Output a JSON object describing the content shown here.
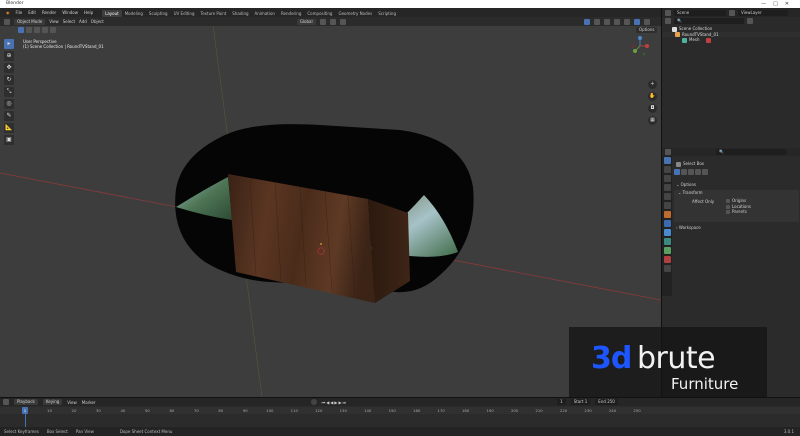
{
  "window": {
    "title": "Blender",
    "controls": [
      "—",
      "□",
      "✕"
    ]
  },
  "menubar": {
    "menus": [
      "File",
      "Edit",
      "Render",
      "Window",
      "Help"
    ],
    "workspaces": [
      "Layout",
      "Modeling",
      "Sculpting",
      "UV Editing",
      "Texture Paint",
      "Shading",
      "Animation",
      "Rendering",
      "Compositing",
      "Geometry Nodes",
      "Scripting"
    ],
    "active_workspace": "Layout"
  },
  "viewport_header": {
    "mode": "Object Mode",
    "menus": [
      "View",
      "Select",
      "Add",
      "Object"
    ],
    "orientation": "Global"
  },
  "viewport": {
    "perspective": "User Perspective",
    "collection_path": "(1) Scene Collection | RoundTVStand_01",
    "options_label": "Options"
  },
  "scene_fields": {
    "scene": "Scene",
    "view_layer": "ViewLayer"
  },
  "outliner": {
    "rows": [
      {
        "label": "Scene Collection",
        "indent": 0
      },
      {
        "label": "RoundTVStand_01",
        "indent": 1
      },
      {
        "label": "Mesh",
        "indent": 2
      }
    ]
  },
  "properties": {
    "tool_name": "Select Box",
    "options_label": "Options",
    "transform_label": "Transform",
    "affect_only_label": "Affect Only",
    "affect_options": [
      "Origins",
      "Locations",
      "Parents"
    ],
    "workspace_label": "Workspace"
  },
  "timeline": {
    "menus": [
      "Playback",
      "Keying",
      "View",
      "Marker"
    ],
    "current_frame": "1",
    "start_label": "Start",
    "start_value": "1",
    "end_label": "End",
    "end_value": "250",
    "ticks": [
      "0",
      "10",
      "20",
      "30",
      "40",
      "50",
      "60",
      "70",
      "80",
      "90",
      "100",
      "110",
      "120",
      "130",
      "140",
      "150",
      "160",
      "170",
      "180",
      "190",
      "200",
      "210",
      "220",
      "230",
      "240",
      "250"
    ]
  },
  "statusbar": {
    "items": [
      "Select Keyframes",
      "Box Select",
      "Pan View",
      "Dope Sheet Context Menu"
    ],
    "version": "3.0.1"
  },
  "watermark": {
    "prefix": "3d",
    "brand": "brute",
    "sub": "Furniture"
  },
  "colors": {
    "accent": "#4772b3",
    "viewport_bg": "#3d3d3d",
    "watermark_blue": "#1d55ff"
  }
}
